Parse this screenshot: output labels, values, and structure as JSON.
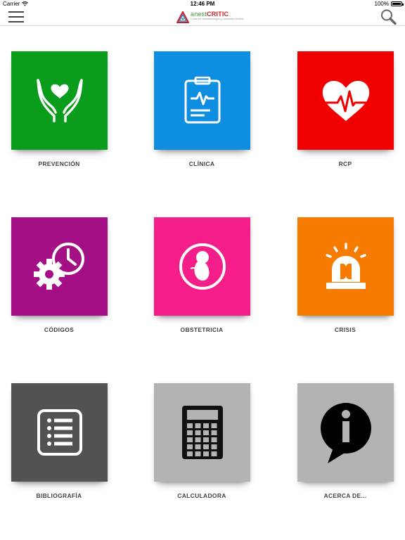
{
  "status_bar": {
    "carrier": "Carrier",
    "time": "12:46 PM",
    "battery": "100%"
  },
  "header": {
    "logo_text_a": "anest",
    "logo_text_b": "CRITIC",
    "logo_subtitle": "Crisis en anestesiología y cuidados críticos",
    "menu_icon": "hamburger-icon",
    "search_icon": "search-icon"
  },
  "tiles": [
    {
      "label": "PREVENCIÓN",
      "color": "#0a9d1c",
      "icon": "heart-hands-icon"
    },
    {
      "label": "CLÍNICA",
      "color": "#0d8ee0",
      "icon": "clipboard-ecg-icon"
    },
    {
      "label": "RCP",
      "color": "#f10000",
      "icon": "heart-pulse-icon"
    },
    {
      "label": "CÓDIGOS",
      "color": "#a50f85",
      "icon": "gear-clock-icon"
    },
    {
      "label": "OBSTETRICIA",
      "color": "#f51d8a",
      "icon": "fetus-icon"
    },
    {
      "label": "CRISIS",
      "color": "#f77b00",
      "icon": "alarm-siren-icon"
    },
    {
      "label": "BIBLIOGRAFÍA",
      "color": "#525252",
      "icon": "list-document-icon"
    },
    {
      "label": "CALCULADORA",
      "color": "#b3b3b3",
      "icon": "calculator-icon"
    },
    {
      "label": "ACERCA DE...",
      "color": "#b3b3b3",
      "icon": "info-bubble-icon"
    }
  ]
}
